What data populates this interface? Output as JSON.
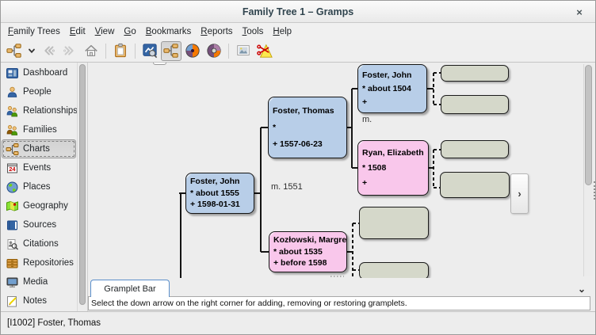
{
  "window": {
    "title": "Family Tree 1 – Gramps",
    "close_icon": "×"
  },
  "menubar": {
    "items": [
      "Family Trees",
      "Edit",
      "View",
      "Go",
      "Bookmarks",
      "Reports",
      "Tools",
      "Help"
    ]
  },
  "toolbar": {
    "buttons": [
      {
        "icon": "pedigree-tree",
        "state": "normal"
      },
      {
        "icon": "chevron-down",
        "state": "normal"
      },
      {
        "icon": "back-arrow",
        "state": "disabled"
      },
      {
        "icon": "forward-arrow",
        "state": "disabled"
      },
      {
        "icon": "home",
        "state": "normal"
      },
      {
        "icon": "clipboard",
        "state": "normal"
      },
      {
        "icon": "chart-gramplet",
        "state": "normal"
      },
      {
        "icon": "pedigree-view",
        "state": "active"
      },
      {
        "icon": "fan-chart",
        "state": "normal"
      },
      {
        "icon": "fan-chart-descendant",
        "state": "normal"
      },
      {
        "icon": "image-export",
        "state": "normal"
      },
      {
        "icon": "scissors-snapshot",
        "state": "normal"
      }
    ]
  },
  "sidebar": {
    "items": [
      {
        "label": "Dashboard",
        "icon": "dashboard-icon",
        "selected": false
      },
      {
        "label": "People",
        "icon": "person-icon",
        "selected": false
      },
      {
        "label": "Relationships",
        "icon": "relationships-icon",
        "selected": false
      },
      {
        "label": "Families",
        "icon": "families-icon",
        "selected": false
      },
      {
        "label": "Charts",
        "icon": "charts-icon",
        "selected": true
      },
      {
        "label": "Events",
        "icon": "events-icon",
        "selected": false
      },
      {
        "label": "Places",
        "icon": "places-icon",
        "selected": false
      },
      {
        "label": "Geography",
        "icon": "geography-icon",
        "selected": false
      },
      {
        "label": "Sources",
        "icon": "sources-icon",
        "selected": false
      },
      {
        "label": "Citations",
        "icon": "citations-icon",
        "selected": false
      },
      {
        "label": "Repositories",
        "icon": "repositories-icon",
        "selected": false
      },
      {
        "label": "Media",
        "icon": "media-icon",
        "selected": false
      },
      {
        "label": "Notes",
        "icon": "notes-icon",
        "selected": false
      }
    ]
  },
  "chart": {
    "persons": [
      {
        "name": "Foster, John",
        "birth": "* about 1555",
        "death": "+ 1598-01-31",
        "sex": "male"
      },
      {
        "name": "Foster, Thomas",
        "birth": "*",
        "death": "+ 1557-06-23",
        "sex": "male"
      },
      {
        "name": "Kozłowski, Margret",
        "birth": "* about 1535",
        "death": "+ before 1598",
        "sex": "female"
      },
      {
        "name": "Foster, John",
        "birth": "* about 1504",
        "death": "+",
        "sex": "male"
      },
      {
        "name": "Ryan, Elizabeth",
        "birth": "* 1508",
        "death": "+",
        "sex": "female"
      }
    ],
    "marriage_labels": [
      {
        "text": "m. 1551"
      },
      {
        "text": "m."
      }
    ],
    "empty_box_count": 6,
    "nav_next_icon": "›",
    "colors": {
      "male_box": "#b8cee8",
      "female_box": "#f9c7eb",
      "unknown_box": "#d5d8ca",
      "canvas": "#ededed"
    }
  },
  "gramplet_bar": {
    "tab_label": "Gramplet Bar",
    "message": "Select the down arrow on the right corner for adding, removing or restoring gramplets.",
    "collapse_icon": "⌄"
  },
  "statusbar": {
    "text": "[I1002] Foster, Thomas"
  }
}
